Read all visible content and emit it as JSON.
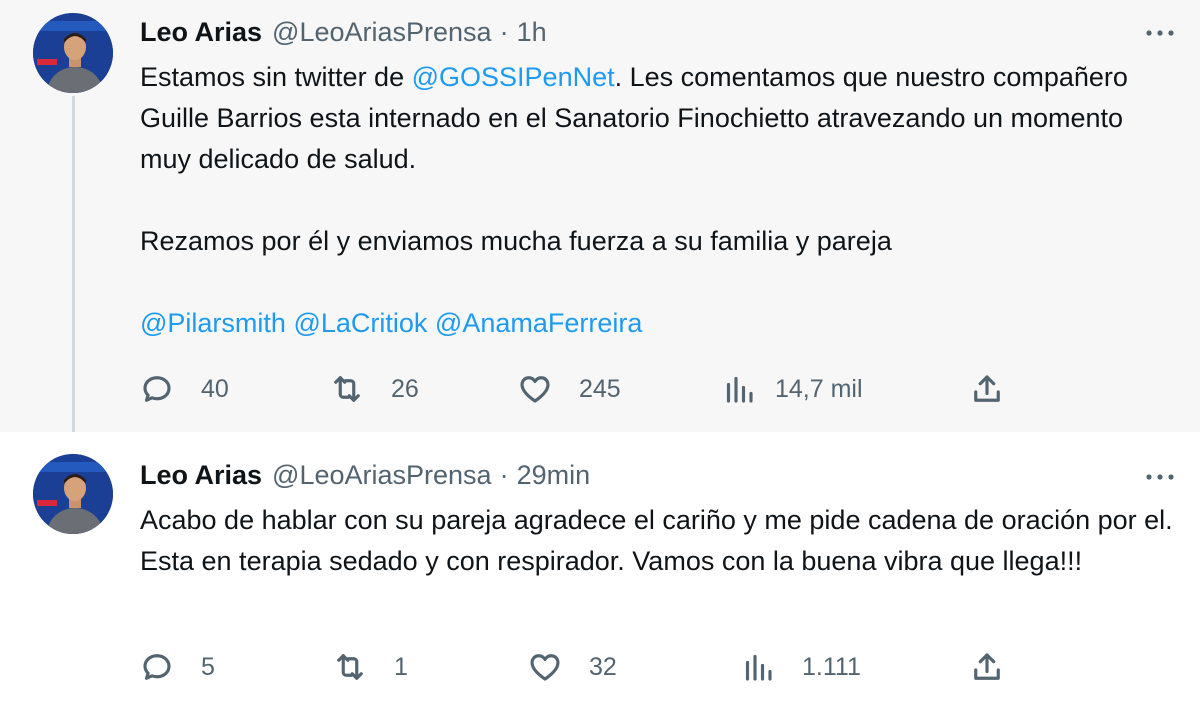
{
  "tweets": [
    {
      "author_name": "Leo Arias",
      "handle": "@LeoAriasPrensa",
      "separator": "·",
      "time": "1h",
      "text_parts": {
        "p1_pre": "Estamos sin twitter de ",
        "p1_mention": "@GOSSIPenNet",
        "p1_post": ".  Les comentamos que nuestro compañero Guille Barrios esta internado en el Sanatorio Finochietto atravezando un momento muy delicado de salud.",
        "p2": "Rezamos por él y enviamos mucha fuerza a su familia y pareja",
        "mentions": [
          "@Pilarsmith",
          "@LaCritiok",
          "@AnamaFerreira"
        ]
      },
      "stats": {
        "replies": "40",
        "retweets": "26",
        "likes": "245",
        "views": "14,7 mil"
      }
    },
    {
      "author_name": "Leo Arias",
      "handle": "@LeoAriasPrensa",
      "separator": "·",
      "time": "29min",
      "text": "Acabo de hablar con su pareja agradece el cariño y me pide cadena de oración por el. Esta en terapia sedado y con respirador. Vamos con la buena vibra que llega!!!",
      "stats": {
        "replies": "5",
        "retweets": "1",
        "likes": "32",
        "views": "1.111"
      }
    }
  ],
  "icons": {
    "more": "more-horizontal-icon",
    "reply": "reply-icon",
    "retweet": "retweet-icon",
    "like": "heart-icon",
    "views": "views-bar-chart-icon",
    "share": "share-icon"
  },
  "colors": {
    "link": "#1d9bf0",
    "muted": "#536471",
    "text": "#0f1419",
    "hover_bg": "#f7f7f7"
  }
}
